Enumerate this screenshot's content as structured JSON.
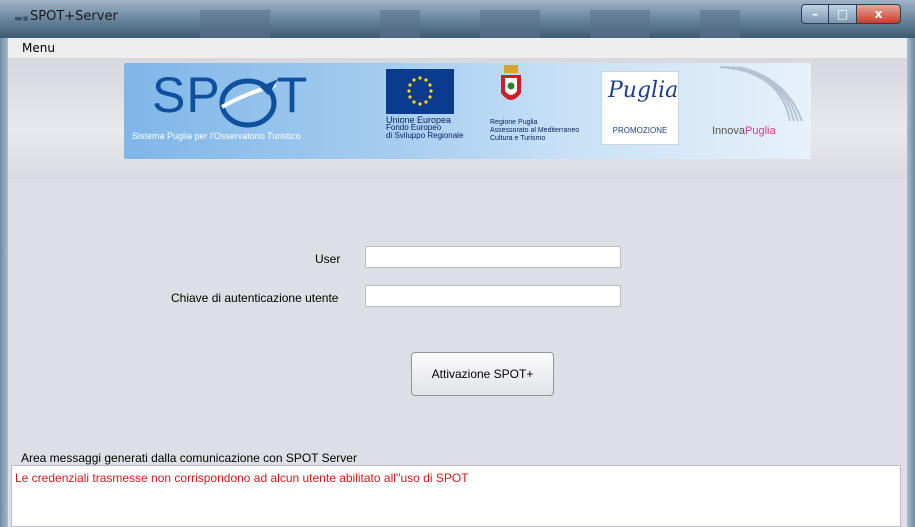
{
  "window": {
    "title": "SPOT+Server",
    "icon": "spot-app-icon",
    "controls": {
      "minimize": "–",
      "maximize": "□",
      "close": "x"
    }
  },
  "menubar": {
    "items": [
      {
        "label": "Menu"
      }
    ]
  },
  "banner": {
    "spot_logo": "SP",
    "spot_logo_end": "T",
    "spot_subtitle": "Sistema Puglia per l'Osservatorio Turistico",
    "eu": {
      "line1": "Unione Europea",
      "line2": "Fondo Europeo",
      "line3": "di Sviluppo Regionale"
    },
    "puglia": {
      "line1": "Regione Puglia",
      "line2": "Assessorato al Mediterraneo",
      "line3": "Cultura e Turismo"
    },
    "promozione": {
      "word": "Puglia",
      "label": "PROMOZIONE"
    },
    "innova": {
      "part1": "Innova",
      "part2": "Puglia"
    }
  },
  "form": {
    "user_label": "User",
    "user_value": "",
    "key_label": "Chiave di autenticazione utente",
    "key_value": "",
    "activate_button": "Attivazione SPOT+"
  },
  "messages": {
    "caption": "Area messaggi generati dalla comunicazione con SPOT Server",
    "text": "Le credenziali trasmesse non corrispondono ad alcun utente abilitato all''uso di SPOT",
    "text_color": "#cc1c1c"
  },
  "colors": {
    "titlebar": "#6f8aa2",
    "content_bg": "#dedfe6",
    "close_button": "#c4402f",
    "spot_blue": "#0e4f9e"
  }
}
